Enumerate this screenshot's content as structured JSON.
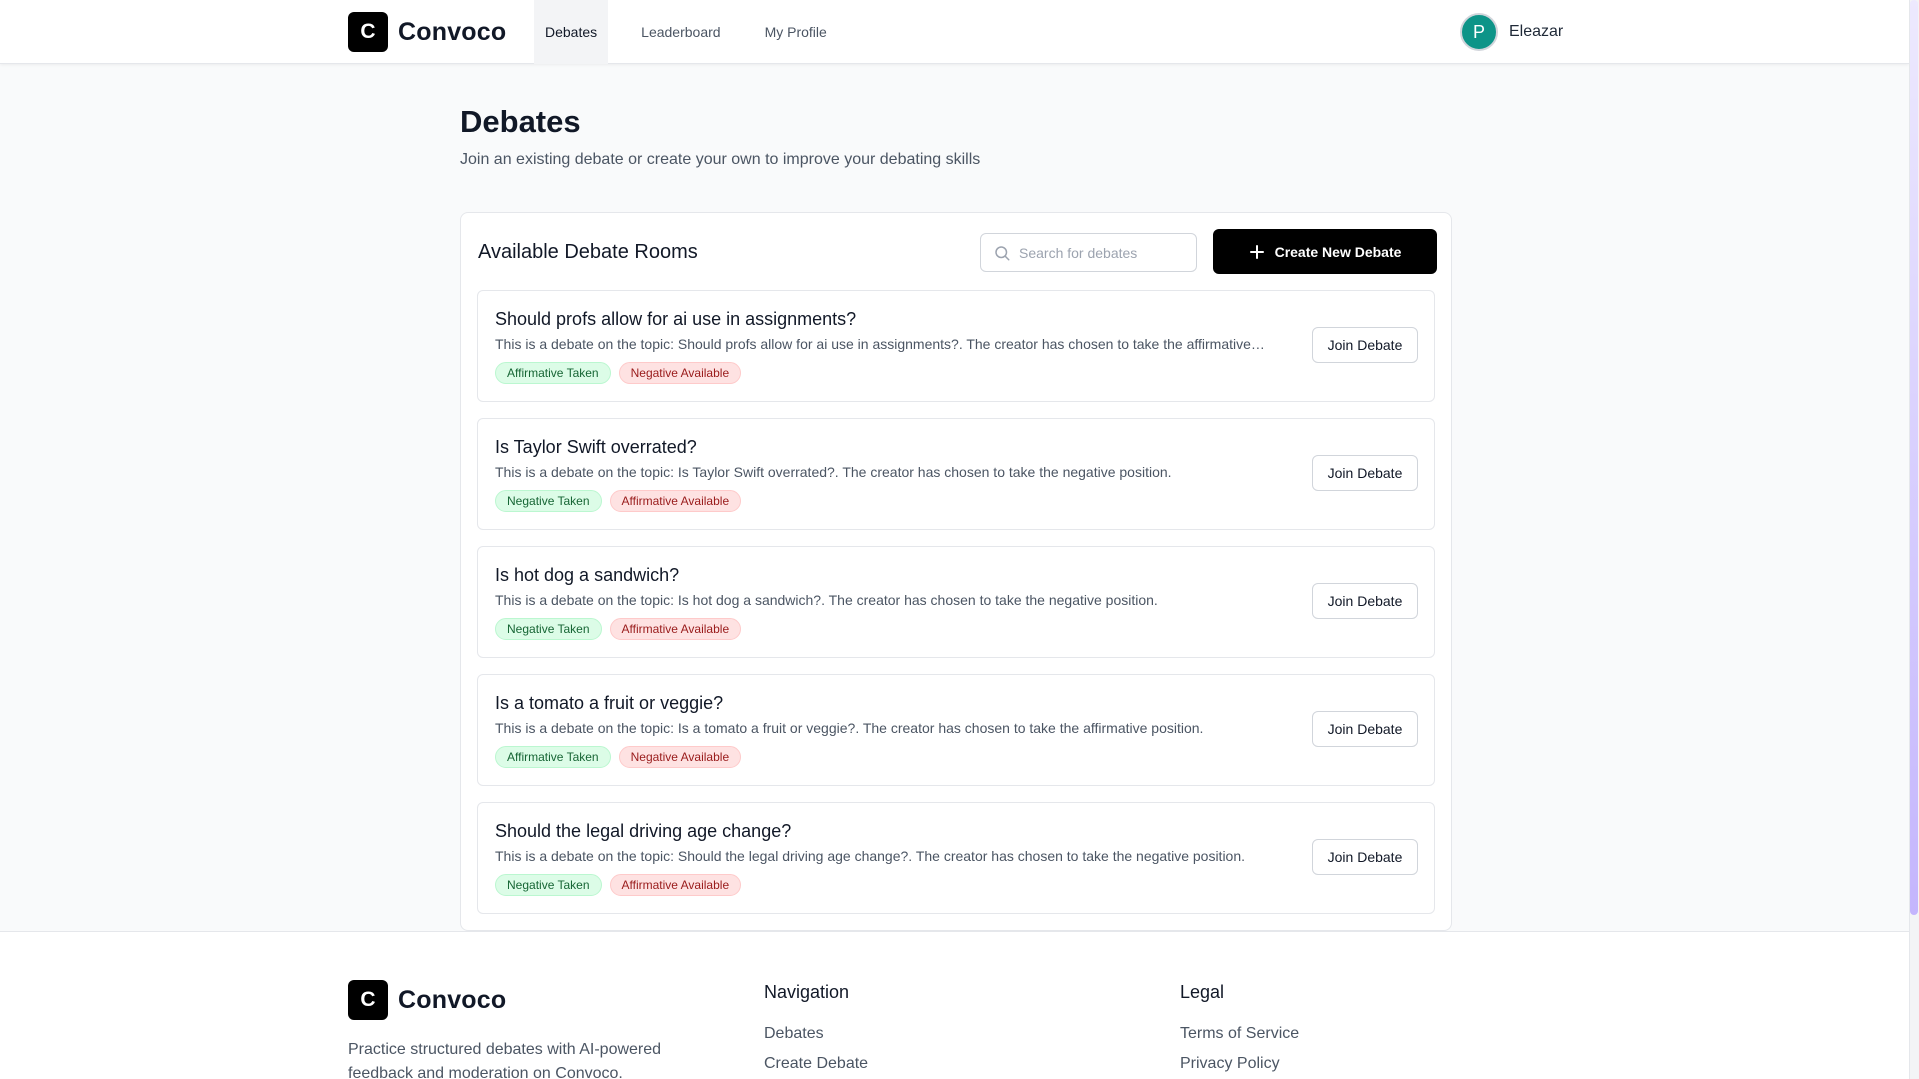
{
  "header": {
    "logo_letter": "C",
    "brand": "Convoco",
    "nav": [
      {
        "label": "Debates",
        "active": true
      },
      {
        "label": "Leaderboard",
        "active": false
      },
      {
        "label": "My Profile",
        "active": false
      }
    ],
    "user": {
      "initial": "P",
      "name": "Eleazar",
      "avatar_color": "#0d9488"
    }
  },
  "page": {
    "title": "Debates",
    "subtitle": "Join an existing debate or create your own to improve your debating skills"
  },
  "panel": {
    "title": "Available Debate Rooms",
    "search_placeholder": "Search for debates",
    "create_label": "Create New Debate",
    "join_label": "Join Debate",
    "debates": [
      {
        "title": "Should profs allow for ai use in assignments?",
        "description": "This is a debate on the topic: Should profs allow for ai use in assignments?. The creator has chosen to take the affirmative position.",
        "taken_badge": "Affirmative Taken",
        "available_badge": "Negative Available"
      },
      {
        "title": "Is Taylor Swift overrated?",
        "description": "This is a debate on the topic: Is Taylor Swift overrated?. The creator has chosen to take the negative position.",
        "taken_badge": "Negative Taken",
        "available_badge": "Affirmative Available"
      },
      {
        "title": "Is hot dog a sandwich?",
        "description": "This is a debate on the topic: Is hot dog a sandwich?. The creator has chosen to take the negative position.",
        "taken_badge": "Negative Taken",
        "available_badge": "Affirmative Available"
      },
      {
        "title": "Is a tomato a fruit or veggie?",
        "description": "This is a debate on the topic: Is a tomato a fruit or veggie?. The creator has chosen to take the affirmative position.",
        "taken_badge": "Affirmative Taken",
        "available_badge": "Negative Available"
      },
      {
        "title": "Should the legal driving age change?",
        "description": "This is a debate on the topic: Should the legal driving age change?. The creator has chosen to take the negative position.",
        "taken_badge": "Negative Taken",
        "available_badge": "Affirmative Available"
      }
    ]
  },
  "footer": {
    "logo_letter": "C",
    "brand": "Convoco",
    "description": "Practice structured debates with AI-powered feedback and moderation on Convoco.",
    "navigation_title": "Navigation",
    "navigation_links": [
      "Debates",
      "Create Debate"
    ],
    "legal_title": "Legal",
    "legal_links": [
      "Terms of Service",
      "Privacy Policy"
    ]
  },
  "colors": {
    "taken_badge_bg": "#dcfce7",
    "available_badge_bg": "#fee2e2",
    "primary_button": "#000000"
  }
}
